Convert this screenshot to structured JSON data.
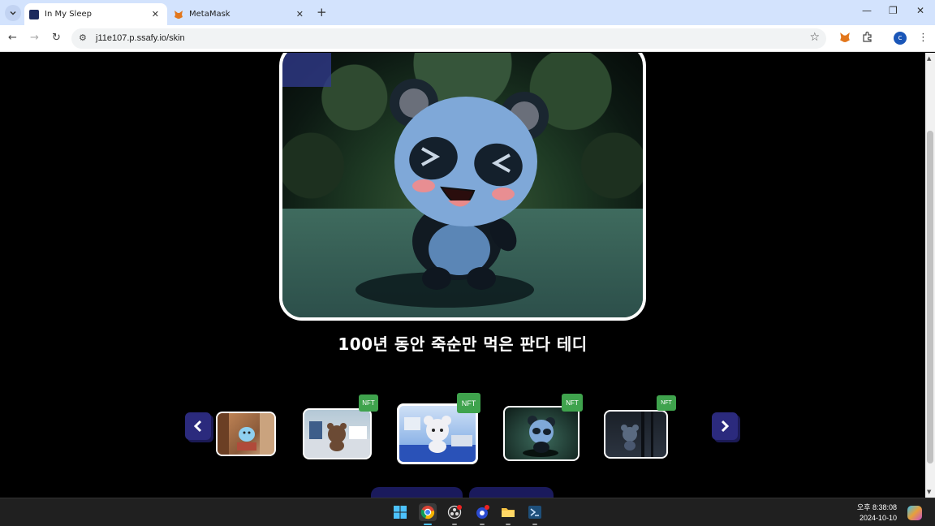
{
  "browser": {
    "tabs": [
      {
        "title": "In My Sleep",
        "active": true,
        "favicon": "app-favicon"
      },
      {
        "title": "MetaMask",
        "active": false,
        "favicon": "fox-icon"
      }
    ],
    "address": "j11e107.p.ssafy.io/skin",
    "profile_initial": "c"
  },
  "page": {
    "skin_title": "100년 동안 죽순만 먹은 판다 테디",
    "nft_label": "NFT",
    "thumbnails": [
      {
        "name": "chick-bedroom",
        "nft": false
      },
      {
        "name": "bear-room",
        "nft": true
      },
      {
        "name": "white-bear-room",
        "nft": true,
        "selected": true
      },
      {
        "name": "panda-forest",
        "nft": true
      },
      {
        "name": "mouse-dark",
        "nft": true
      }
    ]
  },
  "taskbar": {
    "time": "오후 8:38:08",
    "date": "2024-10-10"
  }
}
